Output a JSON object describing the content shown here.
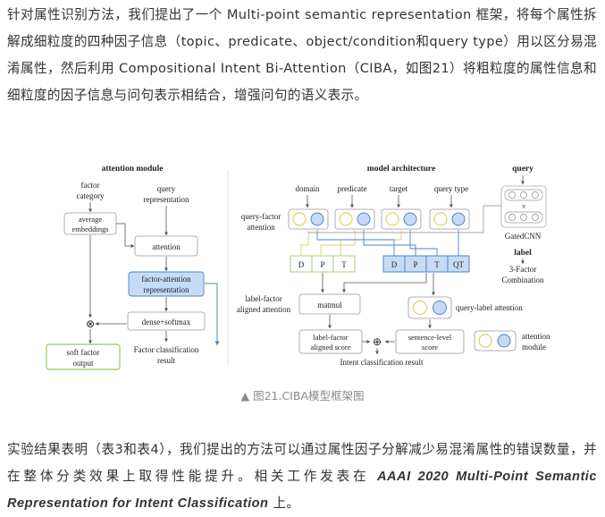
{
  "paragraph1": "针对属性识别方法，我们提出了一个 Multi-point semantic representation 框架，将每个属性拆解成细粒度的四种因子信息（topic、predicate、object/condition和query type）用以区分易混淆属性，然后利用 Compositional Intent Bi-Attention（CIBA，如图21）将粗粒度的属性信息和细粒度的因子信息与问句表示相结合，增强问句的语义表示。",
  "paragraph2": {
    "text": "实验结果表明（表3和表4），我们提出的方法可以通过属性因子分解减少易混淆属性的错误数量，并在整体分类效果上取得性能提升。相关工作发表在 ",
    "emphasis": "AAAI 2020 Multi-Point Semantic Representation for Intent Classification",
    "tail": " 上。"
  },
  "figure": {
    "left_title": "attention module",
    "middle_title": "model architecture",
    "query_title": "query",
    "factor_category": [
      "factor",
      "category"
    ],
    "query_representation": [
      "query",
      "representation"
    ],
    "average_embeddings": [
      "average",
      "embeddings"
    ],
    "attention": "attention",
    "factor_attention_representation": [
      "factor-attention",
      "representation"
    ],
    "dense_softmax": "dense+softmax",
    "otimes": "⊗",
    "soft_factor_output": [
      "soft factor",
      "output"
    ],
    "factor_classification_result": [
      "Factor classification",
      "result"
    ],
    "factor_names": [
      "domain",
      "predicate",
      "target",
      "query type"
    ],
    "query_factor_attention": [
      "query-factor",
      "attention"
    ],
    "gated_cnn": "GatedCNN",
    "times": "×",
    "label": "label",
    "three_factor_combination": [
      "3-Factor",
      "Combination"
    ],
    "label_factors_white": [
      "D",
      "P",
      "T"
    ],
    "label_factors_blue": [
      "D",
      "P",
      "T",
      "QT"
    ],
    "label_factor_aligned_attention": [
      "label-factor",
      "aligned attention"
    ],
    "matmul": "matmul",
    "query_label_attention": "query-label attention",
    "label_factor_aligned_score": [
      "label-factor",
      "aligned score"
    ],
    "oplus": "⊕",
    "sentence_level_score": [
      "sentence-level",
      "score"
    ],
    "intent_classification_result": "Intent classification result",
    "attention_module_legend": [
      "attention",
      "module"
    ]
  },
  "caption": "▲ 图21.CIBA模型框架图",
  "colors": {
    "blue_fill": "#c6dbf5",
    "blue_stroke": "#4a86c8",
    "green_stroke": "#a8cf7a",
    "yellow_stroke": "#e2cf6a",
    "circle_blue": "#c7d9f3"
  }
}
